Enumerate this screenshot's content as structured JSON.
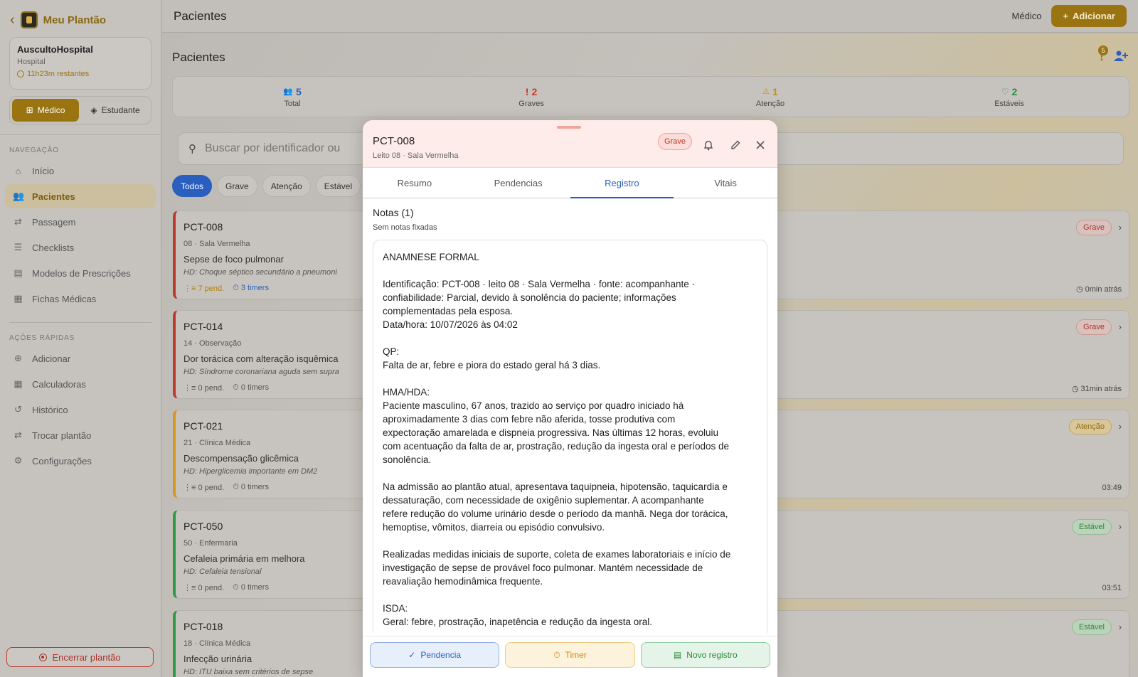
{
  "app": {
    "title": "Meu Plantão"
  },
  "hospital": {
    "name": "AuscultoHospital",
    "type": "Hospital",
    "remaining": "11h23m restantes"
  },
  "roles": [
    {
      "label": "Médico",
      "active": true
    },
    {
      "label": "Estudante",
      "active": false
    }
  ],
  "nav": {
    "section_title": "NAVEGAÇÃO",
    "items": [
      {
        "label": "Início",
        "icon": "home-icon"
      },
      {
        "label": "Pacientes",
        "icon": "users-icon",
        "active": true
      },
      {
        "label": "Passagem",
        "icon": "swap-icon"
      },
      {
        "label": "Checklists",
        "icon": "checklist-icon"
      },
      {
        "label": "Modelos de Prescrições",
        "icon": "document-icon"
      },
      {
        "label": "Fichas Médicas",
        "icon": "clipboard-icon"
      }
    ]
  },
  "quick": {
    "section_title": "AÇÕES RÁPIDAS",
    "items": [
      {
        "label": "Adicionar",
        "icon": "plus-circle-icon"
      },
      {
        "label": "Calculadoras",
        "icon": "calculator-icon"
      },
      {
        "label": "Histórico",
        "icon": "history-icon"
      },
      {
        "label": "Trocar plantão",
        "icon": "swap-icon"
      },
      {
        "label": "Configurações",
        "icon": "gear-icon"
      }
    ]
  },
  "end_shift": {
    "label": "Encerrar plantão"
  },
  "topbar": {
    "title": "Pacientes",
    "role": "Médico",
    "add_label": "Adicionar"
  },
  "page": {
    "title": "Pacientes",
    "alert_count": "5"
  },
  "stats": [
    {
      "value": "5",
      "label": "Total",
      "color": "#2b5fbf",
      "icon": "users-icon"
    },
    {
      "value": "2",
      "label": "Graves",
      "color": "#c0392b",
      "icon": "exclamation-icon"
    },
    {
      "value": "1",
      "label": "Atenção",
      "color": "#c88a12",
      "icon": "warning-icon"
    },
    {
      "value": "2",
      "label": "Estáveis",
      "color": "#2e8a3e",
      "icon": "heart-icon"
    }
  ],
  "search": {
    "placeholder": "Buscar por identificador ou"
  },
  "filters": [
    "Todos",
    "Grave",
    "Atenção",
    "Estável"
  ],
  "patients": [
    {
      "id": "PCT-008",
      "loc": "08 · Sala Vermelha",
      "dx": "Sepse de foco pulmonar",
      "hd": "HD: Choque séptico secundário a pneumoni",
      "pend": "7 pend.",
      "timers": "3 timers",
      "status": "Grave",
      "time": "0min atrás",
      "color": "#c0392b"
    },
    {
      "id": "PCT-014",
      "loc": "14 · Observação",
      "dx": "Dor torácica com alteração isquêmica",
      "hd": "HD: Síndrome coronariana aguda sem supra",
      "pend": "0 pend.",
      "timers": "0 timers",
      "status": "Grave",
      "time": "31min atrás",
      "color": "#c0392b"
    },
    {
      "id": "PCT-021",
      "loc": "21 · Clínica Médica",
      "dx": "Descompensação glicêmica",
      "hd": "HD: Hiperglicemia importante em DM2",
      "pend": "0 pend.",
      "timers": "0 timers",
      "status": "Atenção",
      "time": "03:49",
      "color": "#d9951c"
    },
    {
      "id": "PCT-050",
      "loc": "50 · Enfermaria",
      "dx": "Cefaleia primária em melhora",
      "hd": "HD: Cefaleia tensional",
      "pend": "0 pend.",
      "timers": "0 timers",
      "status": "Estável",
      "time": "03:51",
      "color": "#2e9a44"
    },
    {
      "id": "PCT-018",
      "loc": "18 · Clínica Médica",
      "dx": "Infecção urinária",
      "hd": "HD: ITU baixa sem critérios de sepse",
      "pend": "0 pend.",
      "timers": "0 timers",
      "status": "Estável",
      "time": "",
      "color": "#2e9a44"
    }
  ],
  "modal": {
    "id": "PCT-008",
    "sub": "Leito 08 · Sala Vermelha",
    "badge": "Grave",
    "tabs": [
      "Resumo",
      "Pendencias",
      "Registro",
      "Vitais"
    ],
    "notes_title": "Notas (1)",
    "notes_sub": "Sem notas fixadas",
    "note": "ANAMNESE FORMAL\n\nIdentificação: PCT-008 · leito 08 · Sala Vermelha · fonte: acompanhante · confiabilidade: Parcial, devido à sonolência do paciente; informações complementadas pela esposa.\nData/hora: 10/07/2026 às 04:02\n\nQP:\nFalta de ar, febre e piora do estado geral há 3 dias.\n\nHMA/HDA:\nPaciente masculino, 67 anos, trazido ao serviço por quadro iniciado há aproximadamente 3 dias com febre não aferida, tosse produtiva com expectoração amarelada e dispneia progressiva. Nas últimas 12 horas, evoluiu com acentuação da falta de ar, prostração, redução da ingesta oral e períodos de sonolência.\n\nNa admissão ao plantão atual, apresentava taquipneia, hipotensão, taquicardia e dessaturação, com necessidade de oxigênio suplementar. A acompanhante refere redução do volume urinário desde o período da manhã. Nega dor torácica, hemoptise, vômitos, diarreia ou episódio convulsivo.\n\nRealizadas medidas iniciais de suporte, coleta de exames laboratoriais e início de investigação de sepse de provável foco pulmonar. Mantém necessidade de reavaliação hemodinâmica frequente.\n\nISDA:\nGeral: febre, prostração, inapetência e redução da ingesta oral.",
    "footer": [
      "Pendencia",
      "Timer",
      "Novo registro"
    ]
  }
}
